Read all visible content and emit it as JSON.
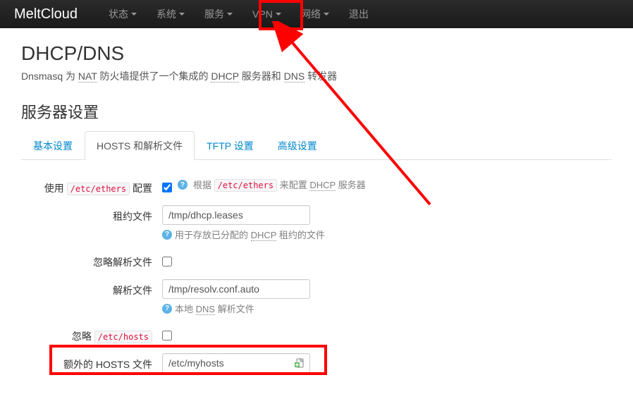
{
  "navbar": {
    "brand": "MeltCloud",
    "items": [
      {
        "label": "状态",
        "caret": true
      },
      {
        "label": "系统",
        "caret": true
      },
      {
        "label": "服务",
        "caret": true
      },
      {
        "label": "VPN",
        "caret": true
      },
      {
        "label": "网络",
        "caret": true
      },
      {
        "label": "退出",
        "caret": false
      }
    ]
  },
  "page": {
    "title": "DHCP/DNS",
    "subtitle_pre": "Dnsmasq 为 ",
    "subtitle_nat": "NAT",
    "subtitle_mid1": " 防火墙提供了一个集成的 ",
    "subtitle_dhcp": "DHCP",
    "subtitle_mid2": " 服务器和 ",
    "subtitle_dns": "DNS",
    "subtitle_end": " 转发器",
    "section_title": "服务器设置"
  },
  "tabs": [
    {
      "label": "基本设置",
      "active": false
    },
    {
      "label": "HOSTS 和解析文件",
      "active": true
    },
    {
      "label": "TFTP 设置",
      "active": false
    },
    {
      "label": "高级设置",
      "active": false
    }
  ],
  "form": {
    "use_ethers": {
      "label_pre": "使用 ",
      "label_code": "/etc/ethers",
      "label_post": " 配置",
      "checked": true,
      "help_pre": "根据 ",
      "help_code": "/etc/ethers",
      "help_mid": " 来配置 ",
      "help_dhcp": "DHCP",
      "help_end": " 服务器"
    },
    "lease_file": {
      "label": "租约文件",
      "value": "/tmp/dhcp.leases",
      "help_pre": "用于存放已分配的 ",
      "help_dhcp": "DHCP",
      "help_end": " 租约的文件"
    },
    "ignore_resolv": {
      "label": "忽略解析文件",
      "checked": false
    },
    "resolv_file": {
      "label": "解析文件",
      "value": "/tmp/resolv.conf.auto",
      "help_pre": "本地 ",
      "help_dns": "DNS",
      "help_end": " 解析文件"
    },
    "ignore_hosts": {
      "label_pre": "忽略 ",
      "label_code": "/etc/hosts",
      "checked": false
    },
    "extra_hosts": {
      "label": "额外的 HOSTS 文件",
      "value": "/etc/myhosts"
    }
  }
}
